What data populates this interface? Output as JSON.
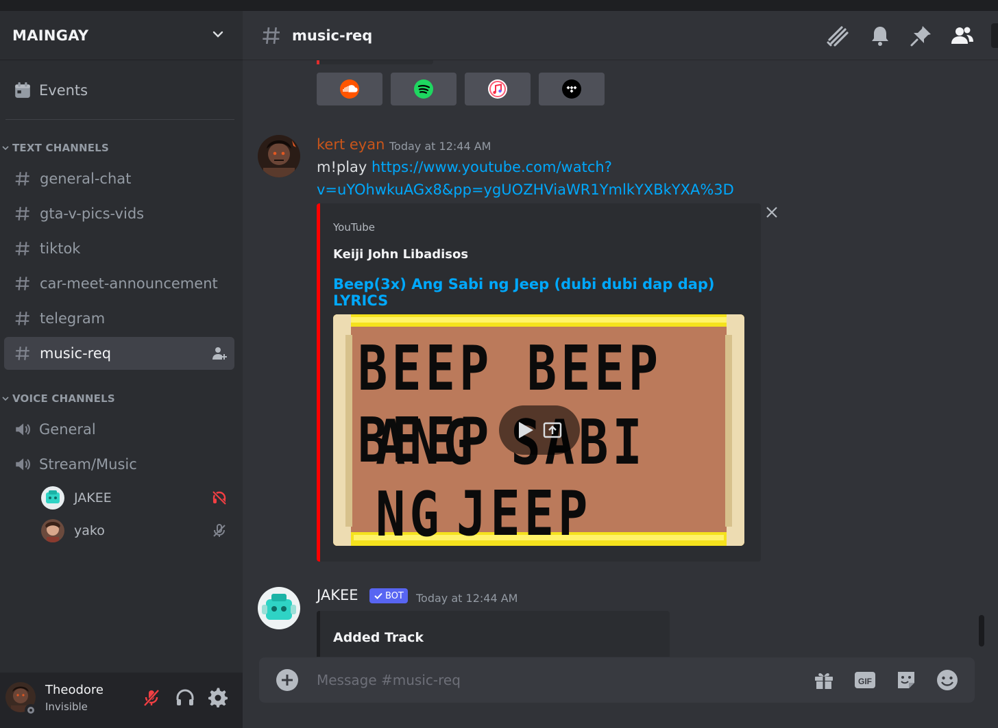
{
  "server": {
    "name": "MAINGAY"
  },
  "sidebar": {
    "events_label": "Events",
    "text_category": "TEXT CHANNELS",
    "text_channels": [
      {
        "label": "general-chat"
      },
      {
        "label": "gta-v-pics-vids"
      },
      {
        "label": "tiktok"
      },
      {
        "label": "car-meet-announcement"
      },
      {
        "label": "telegram"
      },
      {
        "label": "music-req",
        "active": true
      }
    ],
    "voice_category": "VOICE CHANNELS",
    "voice_channels": [
      {
        "label": "General"
      },
      {
        "label": "Stream/Music"
      }
    ],
    "voice_members": [
      {
        "name": "JAKEE",
        "status_icon": "deafened-icon"
      },
      {
        "name": "yako",
        "status_icon": "server-muted-icon"
      }
    ]
  },
  "user_panel": {
    "name": "Theodore",
    "status": "Invisible"
  },
  "channel": {
    "name": "music-req"
  },
  "music_services": [
    "soundcloud-icon",
    "spotify-icon",
    "apple-music-icon",
    "tidal-icon"
  ],
  "messages": [
    {
      "author": "kert eyan",
      "author_color": "#c9551a",
      "time": "Today at 12:44 AM",
      "command": "m!play",
      "link_line1": "https://www.youtube.com/watch?",
      "link_line2": "v=uYOhwkuAGx8&pp=ygUOZHViaWR1YmlkYXBkYXA%3D",
      "embed": {
        "provider": "YouTube",
        "author": "Keiji John Libadisos",
        "title": "Beep(3x) Ang Sabi ng Jeep (dubi dubi dap dap) LYRICS",
        "border_color": "#ff0000",
        "thumbnail": {
          "line1": "BEEP BEEP BEEP",
          "line2": "ANG SABI NG",
          "line3": "JEEP"
        }
      }
    },
    {
      "author": "JAKEE",
      "badge": "BOT",
      "time": "Today at 12:44 AM",
      "embed": {
        "title": "Added Track"
      }
    }
  ],
  "composer": {
    "placeholder": "Message #music-req"
  },
  "colors": {
    "accent": "#5865f2",
    "link": "#00a8fc",
    "youtube_red": "#ff0000"
  }
}
